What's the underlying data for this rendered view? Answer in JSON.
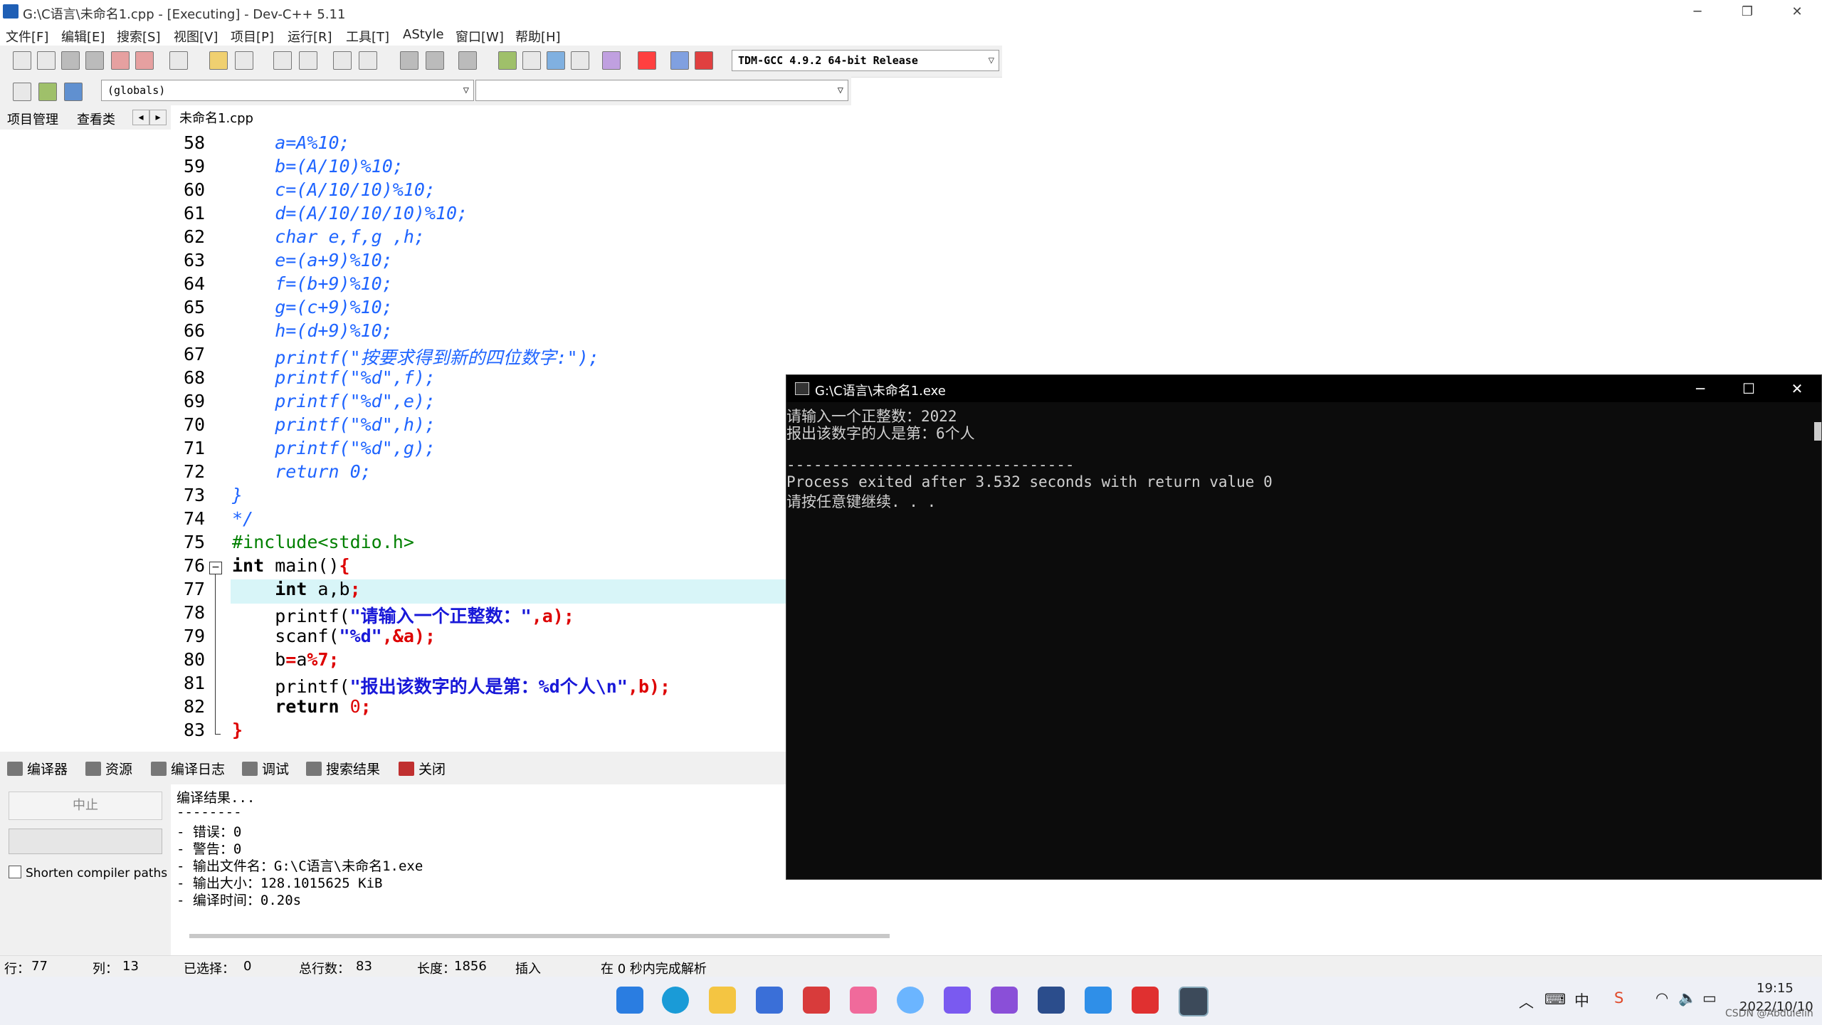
{
  "window": {
    "title": "G:\\C语言\\未命名1.cpp - [Executing] - Dev-C++ 5.11"
  },
  "menu": [
    "文件[F]",
    "编辑[E]",
    "搜索[S]",
    "视图[V]",
    "项目[P]",
    "运行[R]",
    "工具[T]",
    "AStyle",
    "窗口[W]",
    "帮助[H]"
  ],
  "toolbar": {
    "compiler_select": "TDM-GCC 4.9.2 64-bit Release",
    "scope_select": "(globals)",
    "symbol_select": ""
  },
  "left_tabs": [
    "项目管理",
    "查看类"
  ],
  "editor": {
    "file_tab": "未命名1.cpp",
    "line_numbers": [
      "58",
      "59",
      "60",
      "61",
      "62",
      "63",
      "64",
      "65",
      "66",
      "67",
      "68",
      "69",
      "70",
      "71",
      "72",
      "73",
      "74",
      "75",
      "76",
      "77",
      "78",
      "79",
      "80",
      "81",
      "82",
      "83"
    ]
  },
  "code": {
    "l58": "    a=A%10;",
    "l59": "    b=(A/10)%10;",
    "l60": "    c=(A/10/10)%10;",
    "l61": "    d=(A/10/10/10)%10;",
    "l62": "    char e,f,g ,h;",
    "l63": "    e=(a+9)%10;",
    "l64": "    f=(b+9)%10;",
    "l65": "    g=(c+9)%10;",
    "l66": "    h=(d+9)%10;",
    "l67": "    printf(\"按要求得到新的四位数字:\");",
    "l68": "    printf(\"%d\",f);",
    "l69": "    printf(\"%d\",e);",
    "l70": "    printf(\"%d\",h);",
    "l71": "    printf(\"%d\",g);",
    "l72": "    return 0;",
    "l73": "}",
    "l74": "*/",
    "l75": "#include<stdio.h>",
    "l76_kw": "int",
    "l76_rest": " main()",
    "l76_brace": "{",
    "l77_kw": "int",
    "l77_rest": " a,b",
    "l78_fn": "printf(",
    "l78_str": "\"请输入一个正整数：\"",
    "l78_tail": ",a);",
    "l79_fn": "scanf(",
    "l79_str": "\"%d\"",
    "l79_tail": ",&a);",
    "l80_a": "b",
    "l80_b": "=",
    "l80_c": "a",
    "l80_d": "%7;",
    "l81_fn": "printf(",
    "l81_str": "\"报出该数字的人是第：%d个人\\n\"",
    "l81_tail": ",b);",
    "l82_kw": "return",
    "l82_num": "0",
    "l83": "}"
  },
  "bottom_tabs": [
    "编译器",
    "资源",
    "编译日志",
    "调试",
    "搜索结果",
    "关闭"
  ],
  "bottom_left": {
    "abort_label": "中止",
    "shorten_label": "Shorten compiler paths"
  },
  "log": [
    "编译结果...",
    "--------",
    "- 错误：0",
    "- 警告：0",
    "- 输出文件名：G:\\C语言\\未命名1.exe",
    "- 输出大小：128.1015625 KiB",
    "- 编译时间：0.20s"
  ],
  "status": {
    "row_label": "行：",
    "row_value": "77",
    "col_label": "列：",
    "col_value": "13",
    "sel_label": "已选择：",
    "sel_value": "0",
    "total_label": "总行数：",
    "total_value": "83",
    "len_label": "长度：",
    "len_value": "1856",
    "mode": "插入",
    "parse": "在 0 秒内完成解析"
  },
  "console": {
    "title": "G:\\C语言\\未命名1.exe",
    "lines": [
      "请输入一个正整数：2022",
      "报出该数字的人是第：6个人",
      "",
      "--------------------------------",
      "Process exited after 3.532 seconds with return value 0",
      "请按任意键继续. . ."
    ]
  },
  "taskbar": {
    "tray_ime": "中",
    "time": "19:15",
    "date": "2022/10/10",
    "watermark": "CSDN @Abdulelin"
  },
  "colors": {
    "comment": "#1e64ff",
    "string": "#1818d8",
    "symbol": "#d00000",
    "include": "#008000",
    "current_line": "#d8f5f8",
    "console_bg": "#0c0c0c"
  }
}
